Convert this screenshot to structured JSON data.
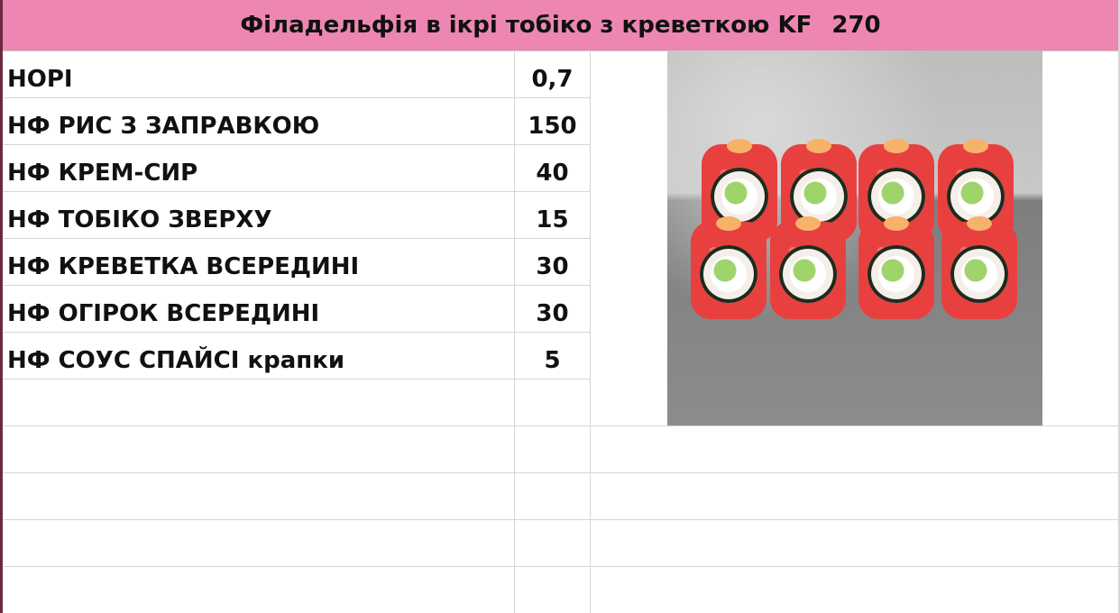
{
  "title": {
    "name": "Філадельфія в ікрі тобіко з креветкою KF",
    "weight": "270"
  },
  "ingredients": [
    {
      "name": "НОРІ",
      "qty": "0,7"
    },
    {
      "name": "НФ РИС З ЗАПРАВКОЮ",
      "qty": "150"
    },
    {
      "name": "НФ КРЕМ-СИР",
      "qty": "40"
    },
    {
      "name": "НФ ТОБІКО ЗВЕРХУ",
      "qty": "15"
    },
    {
      "name": "НФ КРЕВЕТКА ВСЕРЕДИНІ",
      "qty": "30"
    },
    {
      "name": "НФ ОГІРОК ВСЕРЕДИНІ",
      "qty": "30"
    },
    {
      "name": "НФ СОУС СПАЙСІ крапки",
      "qty": "5"
    }
  ],
  "colors": {
    "title_background": "#ed86b2",
    "grid_lines": "#d6d6d6",
    "sheet_left_border": "#6b2a3d"
  },
  "image": {
    "subject": "sushi-rolls-photo"
  }
}
